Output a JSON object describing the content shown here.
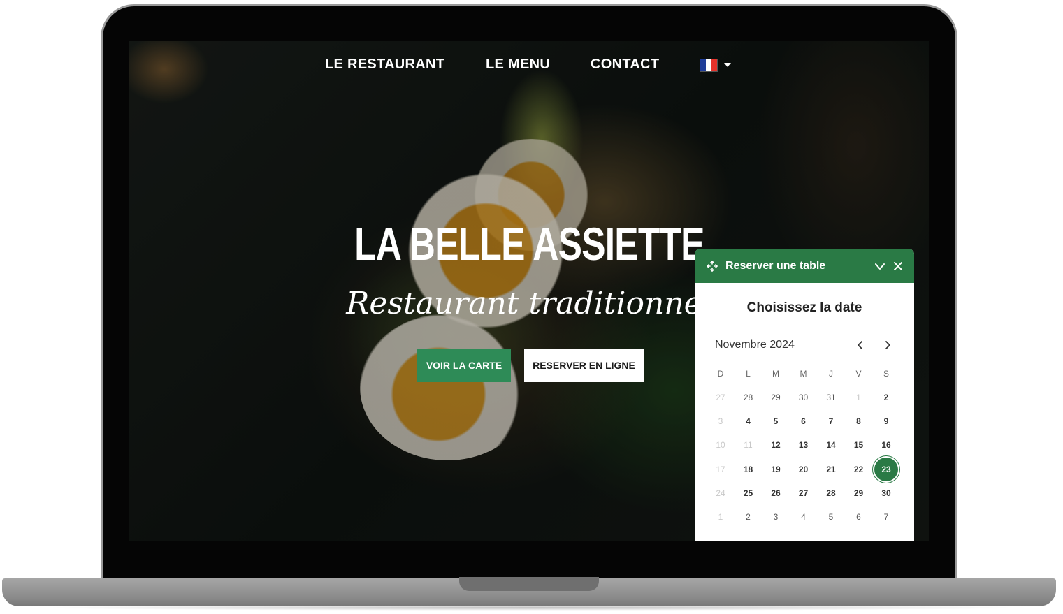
{
  "nav": {
    "items": [
      "LE RESTAURANT",
      "LE MENU",
      "CONTACT"
    ],
    "language": {
      "flag": "fr-flag-icon",
      "dropdown_icon": "caret-down-icon",
      "flag_colors": [
        "#1f3d99",
        "#ffffff",
        "#e4322b"
      ]
    }
  },
  "hero": {
    "title": "LA BELLE ASSIETTE",
    "subtitle": "Restaurant traditionnel",
    "btn_menu": "VOIR LA CARTE",
    "btn_reserve": "RESERVER  EN LIGNE"
  },
  "widget": {
    "title": "Reserver une table",
    "icons": {
      "move": "move-icon",
      "collapse": "chevron-down-icon",
      "close": "close-icon"
    },
    "choose_date": "Choisissez la date",
    "month": "Novembre 2024",
    "prev_icon": "chevron-left-icon",
    "next_icon": "chevron-right-icon",
    "weekdays": [
      "D",
      "L",
      "M",
      "M",
      "J",
      "V",
      "S"
    ],
    "weeks": [
      [
        "27",
        "28",
        "29",
        "30",
        "31",
        "1",
        "2"
      ],
      [
        "3",
        "4",
        "5",
        "6",
        "7",
        "8",
        "9"
      ],
      [
        "10",
        "11",
        "12",
        "13",
        "14",
        "15",
        "16"
      ],
      [
        "17",
        "18",
        "19",
        "20",
        "21",
        "22",
        "23"
      ],
      [
        "24",
        "25",
        "26",
        "27",
        "28",
        "29",
        "30"
      ],
      [
        "1",
        "2",
        "3",
        "4",
        "5",
        "6",
        "7"
      ]
    ],
    "muted_cells": [
      "0.0",
      "0.5",
      "1.0",
      "2.0",
      "2.1",
      "3.0",
      "4.0",
      "5.0"
    ],
    "other_month_cells": [
      "0.1",
      "0.2",
      "0.3",
      "0.4",
      "5.1",
      "5.2",
      "5.3",
      "5.4",
      "5.5",
      "5.6"
    ],
    "selected": "23",
    "colors": {
      "accent": "#2a7a45",
      "button_green": "#2e8b57"
    }
  }
}
